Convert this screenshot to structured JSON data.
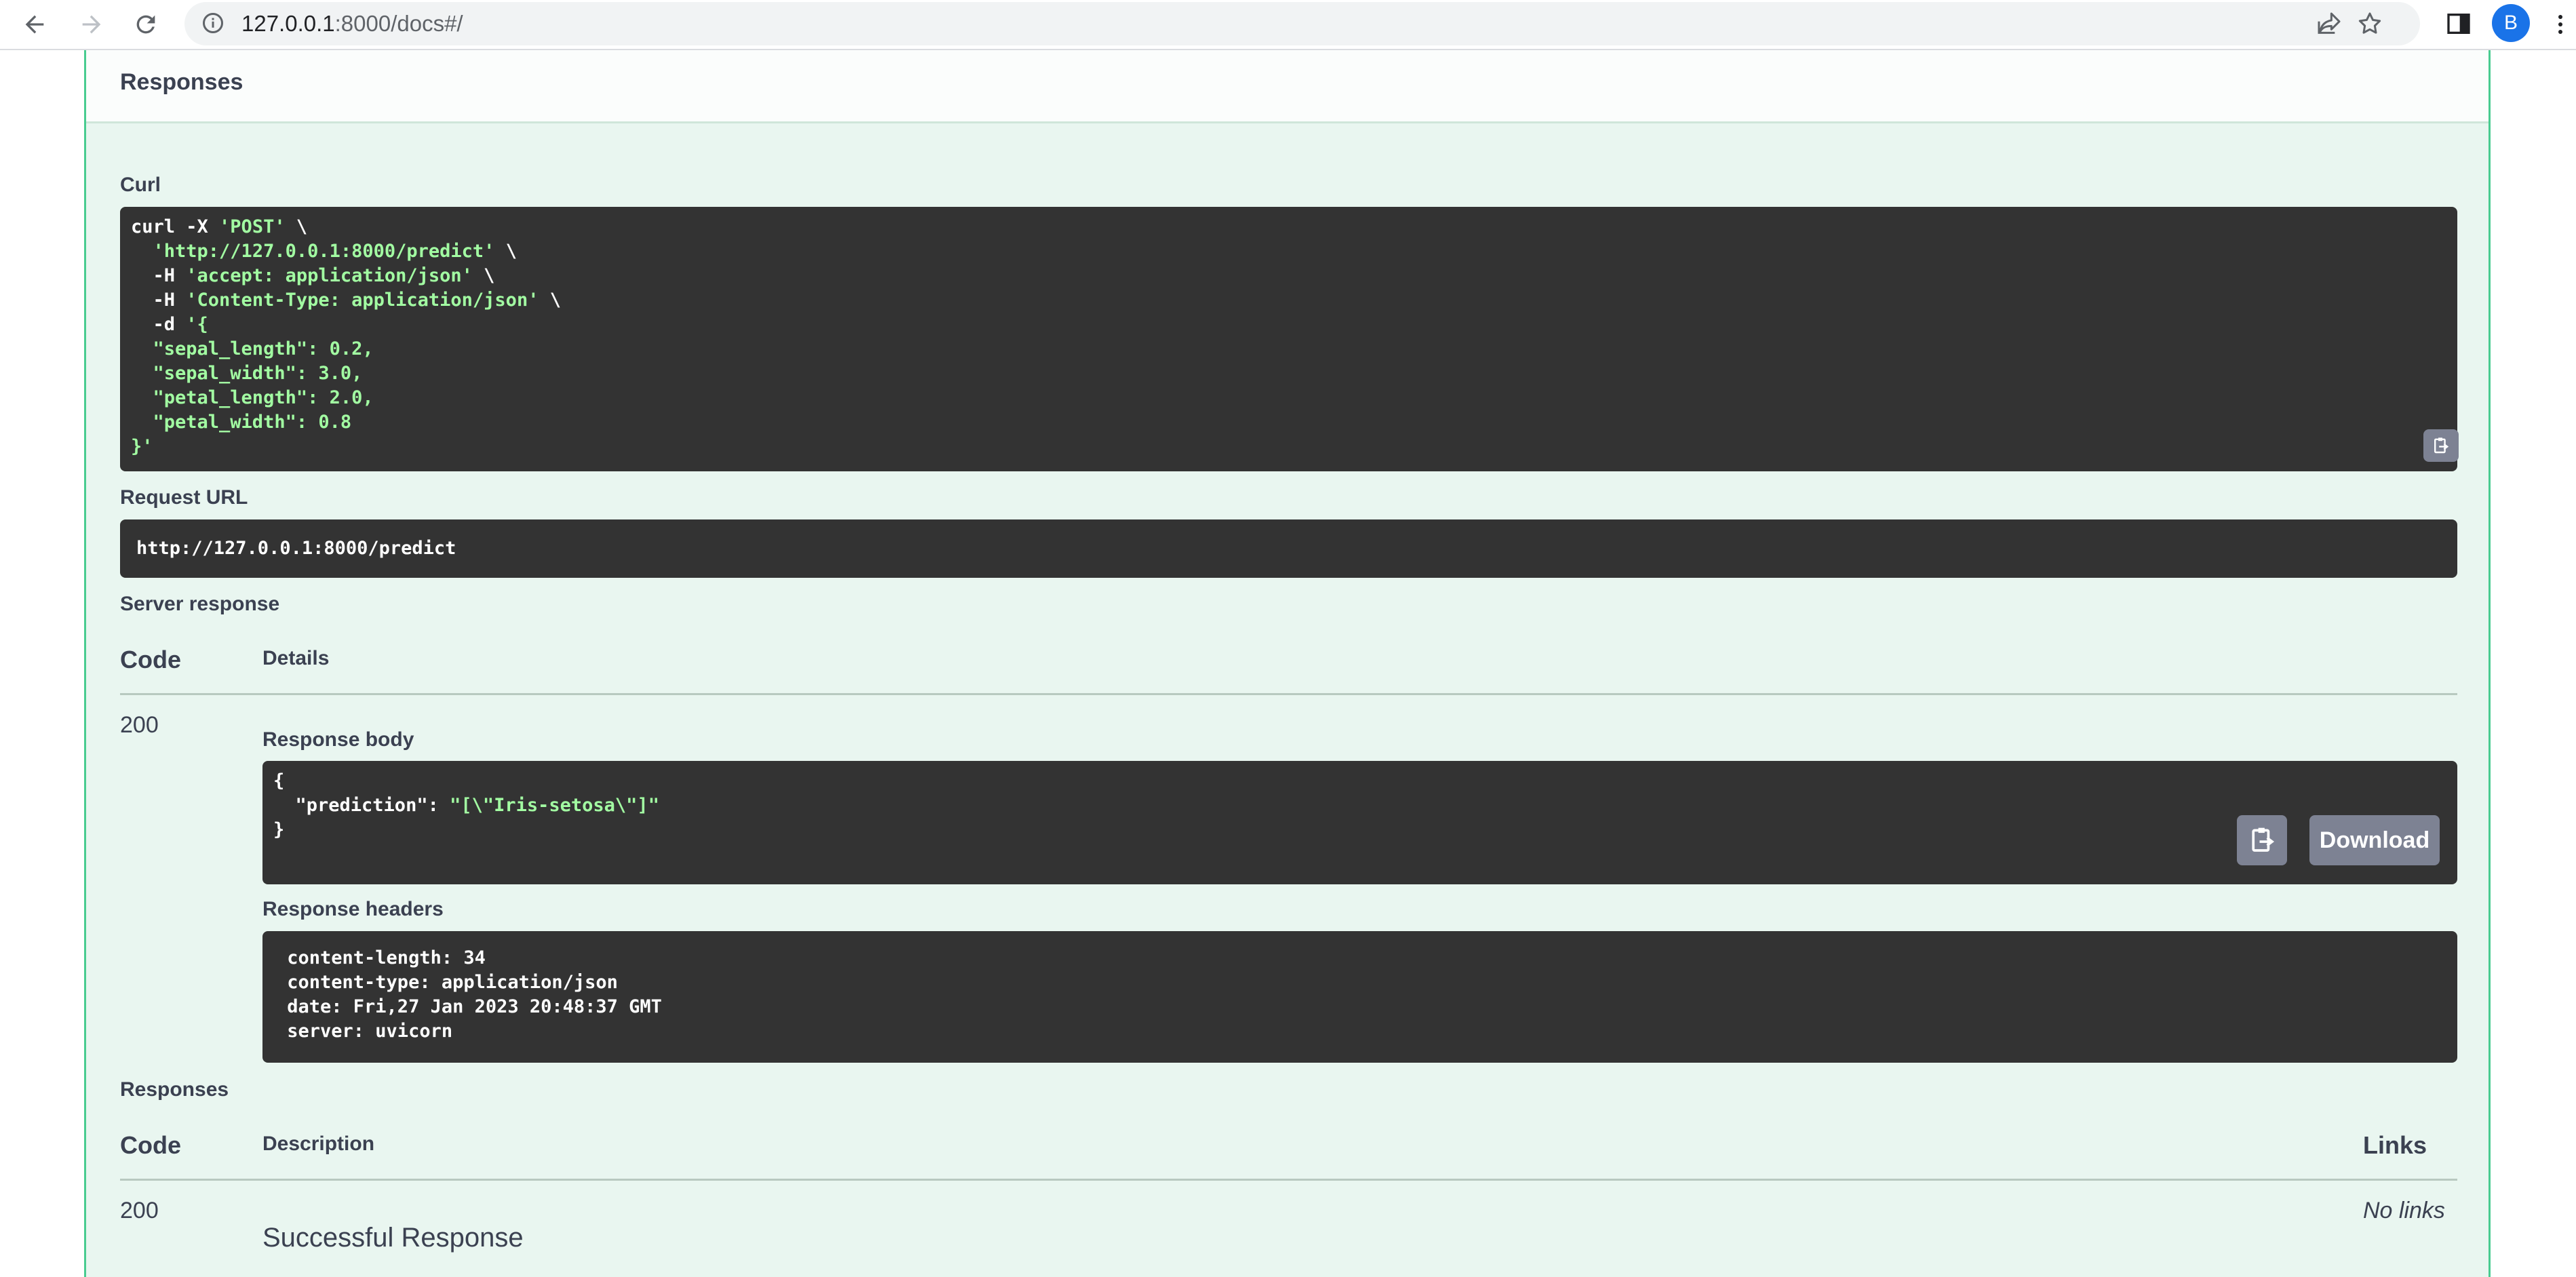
{
  "browser": {
    "url_host": "127.0.0.1",
    "url_path": ":8000/docs#/",
    "profile_initial": "B",
    "accent_color": "#1a73e8"
  },
  "responses_section": {
    "title": "Responses"
  },
  "curl": {
    "label": "Curl",
    "lines": [
      [
        {
          "t": "curl -X ",
          "s": false
        },
        {
          "t": "'POST'",
          "s": true
        },
        {
          "t": " \\",
          "s": false
        }
      ],
      [
        {
          "t": "  ",
          "s": false
        },
        {
          "t": "'http://127.0.0.1:8000/predict'",
          "s": true
        },
        {
          "t": " \\",
          "s": false
        }
      ],
      [
        {
          "t": "  -H ",
          "s": false
        },
        {
          "t": "'accept: application/json'",
          "s": true
        },
        {
          "t": " \\",
          "s": false
        }
      ],
      [
        {
          "t": "  -H ",
          "s": false
        },
        {
          "t": "'Content-Type: application/json'",
          "s": true
        },
        {
          "t": " \\",
          "s": false
        }
      ],
      [
        {
          "t": "  -d ",
          "s": false
        },
        {
          "t": "'{",
          "s": true
        }
      ],
      [
        {
          "t": "  \"sepal_length\": 0.2,",
          "s": true
        }
      ],
      [
        {
          "t": "  \"sepal_width\": 3.0,",
          "s": true
        }
      ],
      [
        {
          "t": "  \"petal_length\": 2.0,",
          "s": true
        }
      ],
      [
        {
          "t": "  \"petal_width\": 0.8",
          "s": true
        }
      ],
      [
        {
          "t": "}'",
          "s": true
        }
      ]
    ]
  },
  "request_url": {
    "label": "Request URL",
    "value": "http://127.0.0.1:8000/predict"
  },
  "server_response": {
    "label": "Server response",
    "code_header": "Code",
    "details_header": "Details",
    "code": "200",
    "response_body_label": "Response body",
    "response_body_lines": [
      [
        {
          "t": "{",
          "s": false
        }
      ],
      [
        {
          "t": "  \"prediction\": ",
          "s": false
        },
        {
          "t": "\"[\\\"Iris-setosa\\\"]\"",
          "s": true
        }
      ],
      [
        {
          "t": "}",
          "s": false
        }
      ]
    ],
    "download_label": "Download",
    "response_headers_label": "Response headers",
    "response_headers_lines": [
      [
        {
          "t": " content-length: 34",
          "s": false
        }
      ],
      [
        {
          "t": " content-type: application/json",
          "s": false
        }
      ],
      [
        {
          "t": " date: Fri,27 Jan 2023 20:48:37 GMT",
          "s": false
        }
      ],
      [
        {
          "t": " server: uvicorn",
          "s": false
        }
      ]
    ]
  },
  "responses_table": {
    "label": "Responses",
    "code_header": "Code",
    "description_header": "Description",
    "links_header": "Links",
    "rows": [
      {
        "code": "200",
        "description": "Successful Response",
        "links": "No links"
      }
    ]
  },
  "colors": {
    "post_green": "#49cc90",
    "section_bg": "#e9f6f0",
    "code_bg": "#333333",
    "string_green": "#a2fca2",
    "button_grey": "#7d8293"
  },
  "icons": {
    "back": "arrow-left-icon",
    "forward": "arrow-right-icon",
    "reload": "reload-icon",
    "info": "info-icon",
    "share": "share-icon",
    "bookmark": "star-icon",
    "side_panel": "side-panel-icon",
    "menu": "kebab-menu-icon",
    "copy": "clipboard-copy-icon"
  }
}
